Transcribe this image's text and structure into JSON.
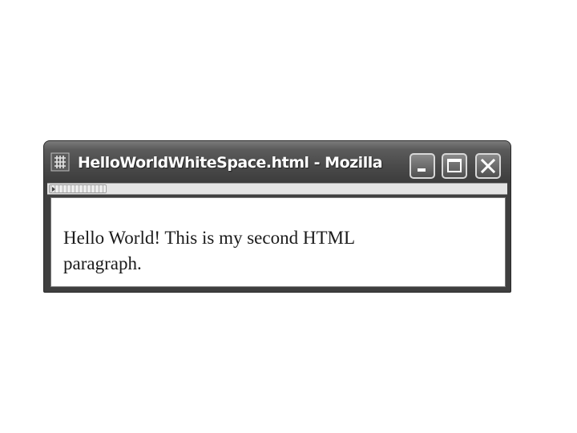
{
  "window": {
    "title": "HelloWorldWhiteSpace.html - Mozilla",
    "app_icon": "mozilla-app-icon",
    "controls": {
      "minimize_icon": "minimize-icon",
      "maximize_icon": "maximize-icon",
      "close_icon": "close-icon"
    }
  },
  "toolbar": {
    "grip_icon": "toolbar-grip-icon"
  },
  "content": {
    "paragraph": "Hello World! This is my second HTML paragraph."
  },
  "colors": {
    "titlebar": "#4a4a4a",
    "title_text": "#ffffff",
    "content_background": "#ffffff",
    "content_text": "#1a1a1a"
  }
}
